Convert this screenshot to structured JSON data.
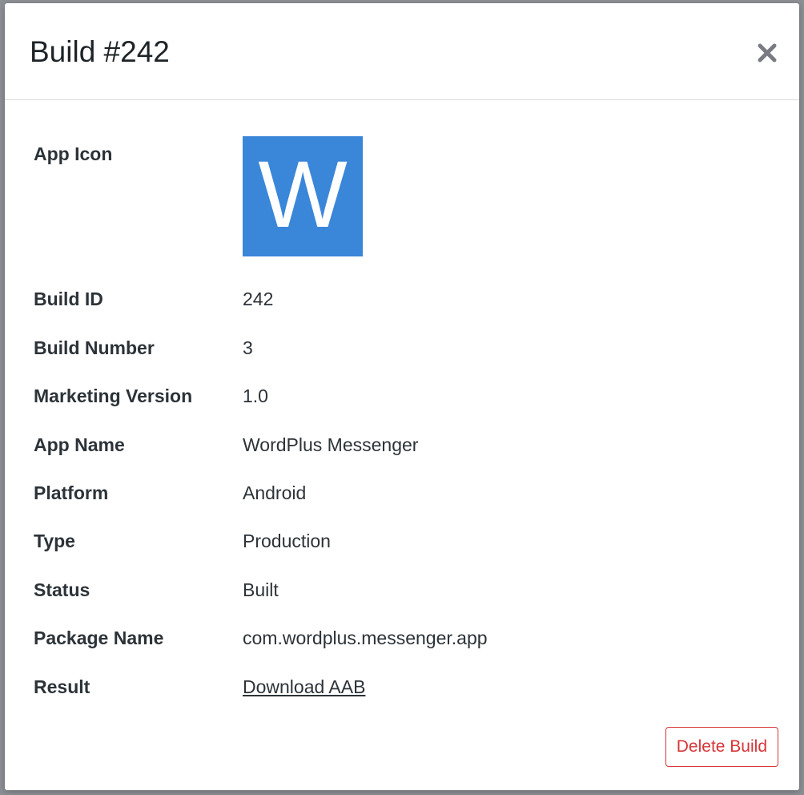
{
  "modal": {
    "title": "Build #242",
    "close_icon": "close-icon"
  },
  "details": {
    "app_icon": {
      "label": "App Icon",
      "letter": "W",
      "color": "#3a86d9"
    },
    "rows": [
      {
        "label": "Build ID",
        "value": "242"
      },
      {
        "label": "Build Number",
        "value": "3"
      },
      {
        "label": "Marketing Version",
        "value": "1.0"
      },
      {
        "label": "App Name",
        "value": "WordPlus Messenger"
      },
      {
        "label": "Platform",
        "value": "Android"
      },
      {
        "label": "Type",
        "value": "Production"
      },
      {
        "label": "Status",
        "value": "Built"
      },
      {
        "label": "Package Name",
        "value": "com.wordplus.messenger.app"
      }
    ],
    "result": {
      "label": "Result",
      "link_text": "Download AAB"
    }
  },
  "actions": {
    "delete_label": "Delete Build",
    "delete_color": "#d63638"
  }
}
